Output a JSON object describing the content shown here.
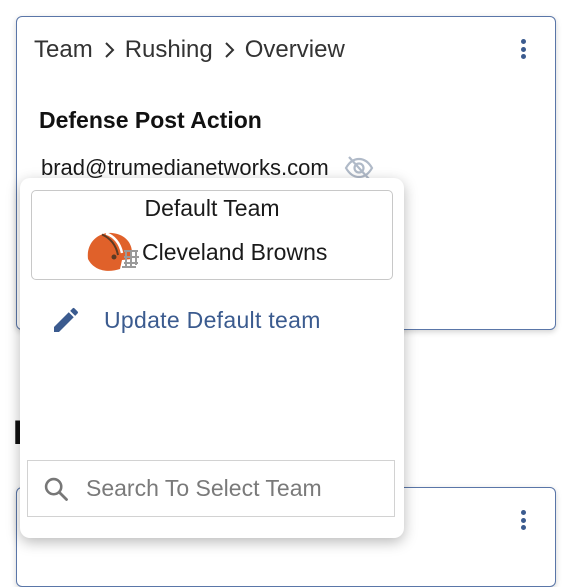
{
  "card": {
    "breadcrumb": [
      "Team",
      "Rushing",
      "Overview"
    ],
    "section_title": "Defense Post Action",
    "email": "brad@trumedianetworks.com"
  },
  "background_heading_fragment": "F",
  "popover": {
    "default_team_label": "Default Team",
    "team_name": "Cleveland Browns",
    "team_logo": "cleveland-browns-helmet",
    "update_button_label": "Update Default team",
    "search": {
      "placeholder": "Search To Select Team",
      "value": ""
    }
  },
  "colors": {
    "accent": "#3b5b8f",
    "card_border": "#5a76a8",
    "helmet_orange": "#e0612a"
  },
  "icons": {
    "eye": "eye-off-icon",
    "menu": "kebab-menu-icon",
    "pencil": "pencil-icon",
    "search": "search-icon",
    "separator": "chevron-right-icon"
  }
}
